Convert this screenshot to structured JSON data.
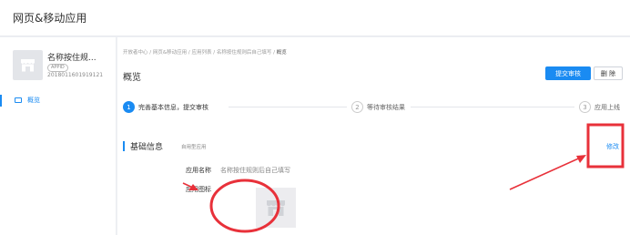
{
  "header": {
    "title": "网页&移动应用"
  },
  "sidebar": {
    "app": {
      "name": "名称按住规...",
      "tag": "APPID",
      "id": "2018011601919121"
    },
    "nav": [
      {
        "label": "概览"
      }
    ]
  },
  "main": {
    "breadcrumb": {
      "path": "开放者中心 / 网页&移动应用 / 应用列表 / 名称按住规则后自己填写 / ",
      "current": "概览"
    },
    "title": "概览",
    "buttons": {
      "submit": "提交审核",
      "delete": "删 除"
    },
    "steps": [
      {
        "num": "1",
        "label": "完善基本信息，提交审核"
      },
      {
        "num": "2",
        "label": "等待审核结果"
      },
      {
        "num": "3",
        "label": "应用上线"
      }
    ],
    "section": {
      "title": "基础信息",
      "subtitle": "自用型应用",
      "edit": "修改"
    },
    "fields": {
      "name_label": "应用名称",
      "name_value": "名称按住规则后自己填写",
      "icon_label": "应用图标"
    }
  },
  "colors": {
    "accent": "#1a8bf2",
    "annotation": "#e8313a"
  },
  "icons": {
    "app_icon": "store-icon",
    "nav_icon": "monitor-icon"
  }
}
